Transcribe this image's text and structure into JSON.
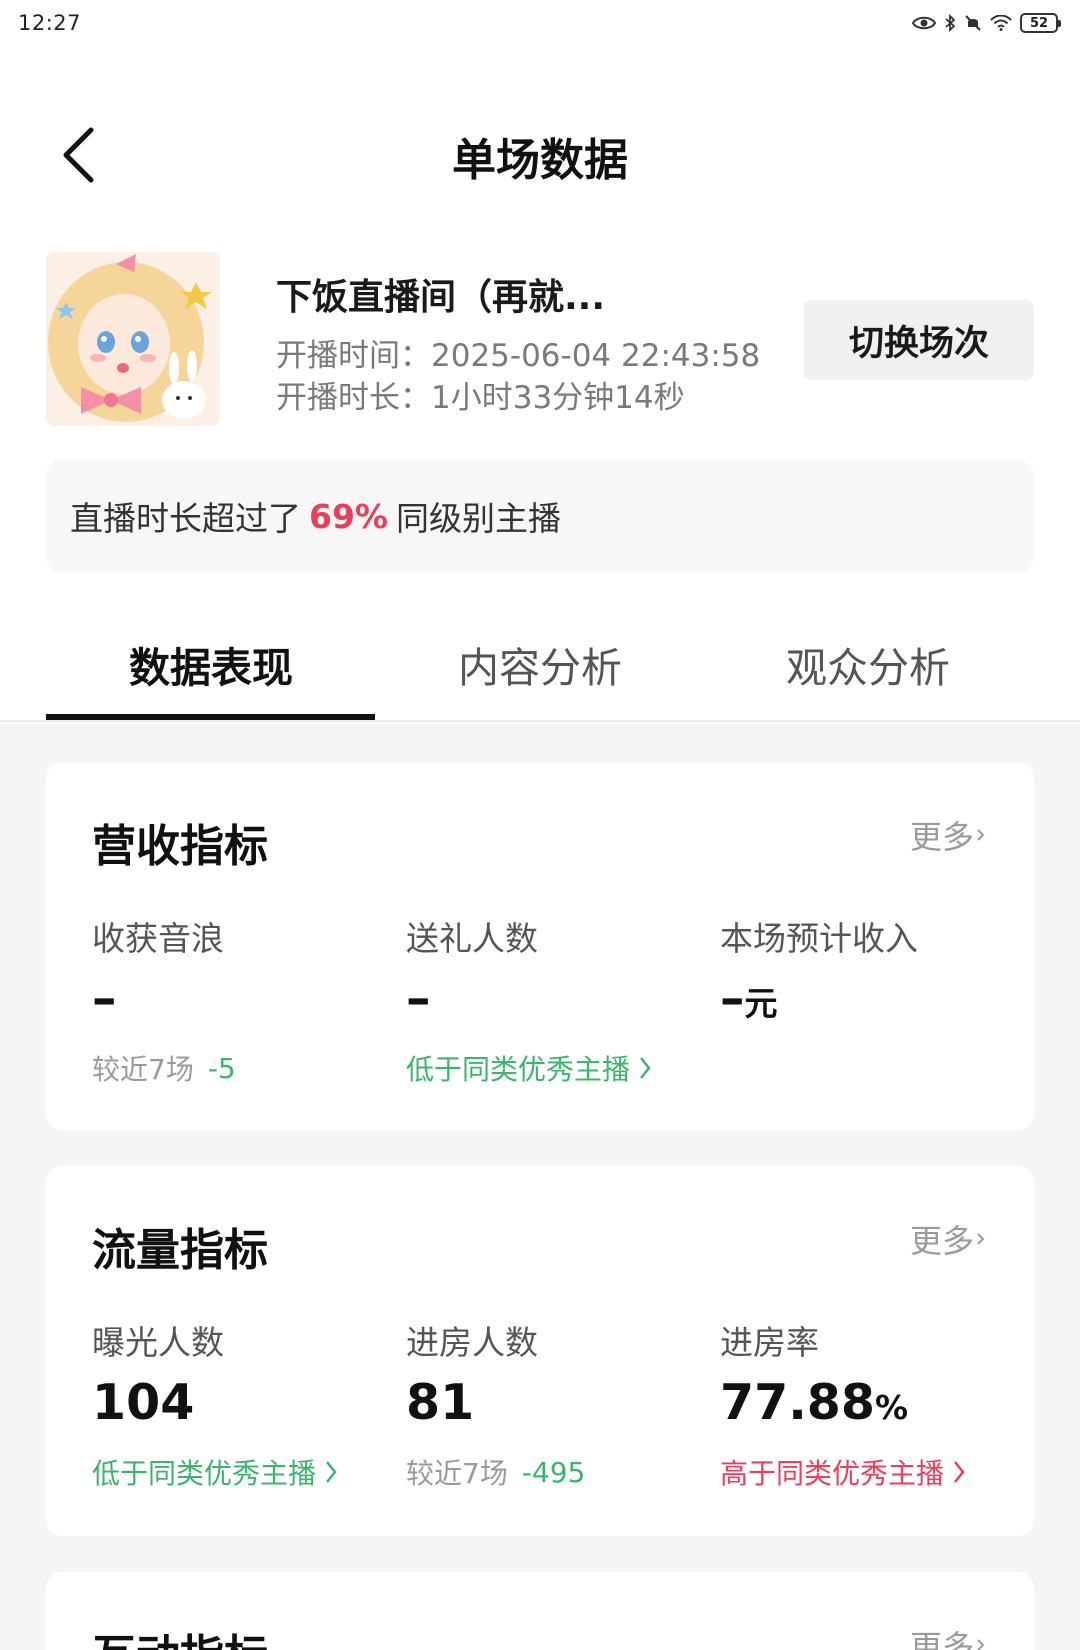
{
  "status_bar": {
    "time": "12:27",
    "battery": "52"
  },
  "header": {
    "title": "单场数据"
  },
  "session": {
    "room_name": "下饭直播间（再就...",
    "start_label": "开播时间：",
    "start_time": "2025-06-04 22:43:58",
    "duration_label": "开播时长：",
    "duration": "1小时33分钟14秒",
    "switch_label": "切换场次"
  },
  "compare": {
    "prefix": "直播时长超过了",
    "percent": "69%",
    "suffix": "同级别主播"
  },
  "tabs": [
    {
      "label": "数据表现",
      "active": true
    },
    {
      "label": "内容分析",
      "active": false
    },
    {
      "label": "观众分析",
      "active": false
    }
  ],
  "revenue": {
    "title": "营收指标",
    "more": "更多",
    "metrics": [
      {
        "label": "收获音浪",
        "value": "–",
        "unit": "",
        "note_prefix": "较近7场",
        "note_delta": "-5"
      },
      {
        "label": "送礼人数",
        "value": "–",
        "unit": "",
        "note": "低于同类优秀主播"
      },
      {
        "label": "本场预计收入",
        "value": "–",
        "unit": "元"
      }
    ]
  },
  "traffic": {
    "title": "流量指标",
    "more": "更多",
    "metrics": [
      {
        "label": "曝光人数",
        "value": "104",
        "unit": "",
        "note": "低于同类优秀主播"
      },
      {
        "label": "进房人数",
        "value": "81",
        "unit": "",
        "note_prefix": "较近7场",
        "note_delta": "-495"
      },
      {
        "label": "进房率",
        "value": "77.88",
        "unit": "%",
        "note": "高于同类优秀主播"
      }
    ]
  },
  "interaction": {
    "title": "互动指标",
    "more": "更多"
  },
  "colors": {
    "accent_red": "#e8405a",
    "accent_green": "#3cb46e"
  },
  "icons": [
    "back-arrow-icon",
    "eye-icon",
    "bluetooth-icon",
    "mute-icon",
    "wifi-icon",
    "battery-icon",
    "chevron-right-icon"
  ]
}
